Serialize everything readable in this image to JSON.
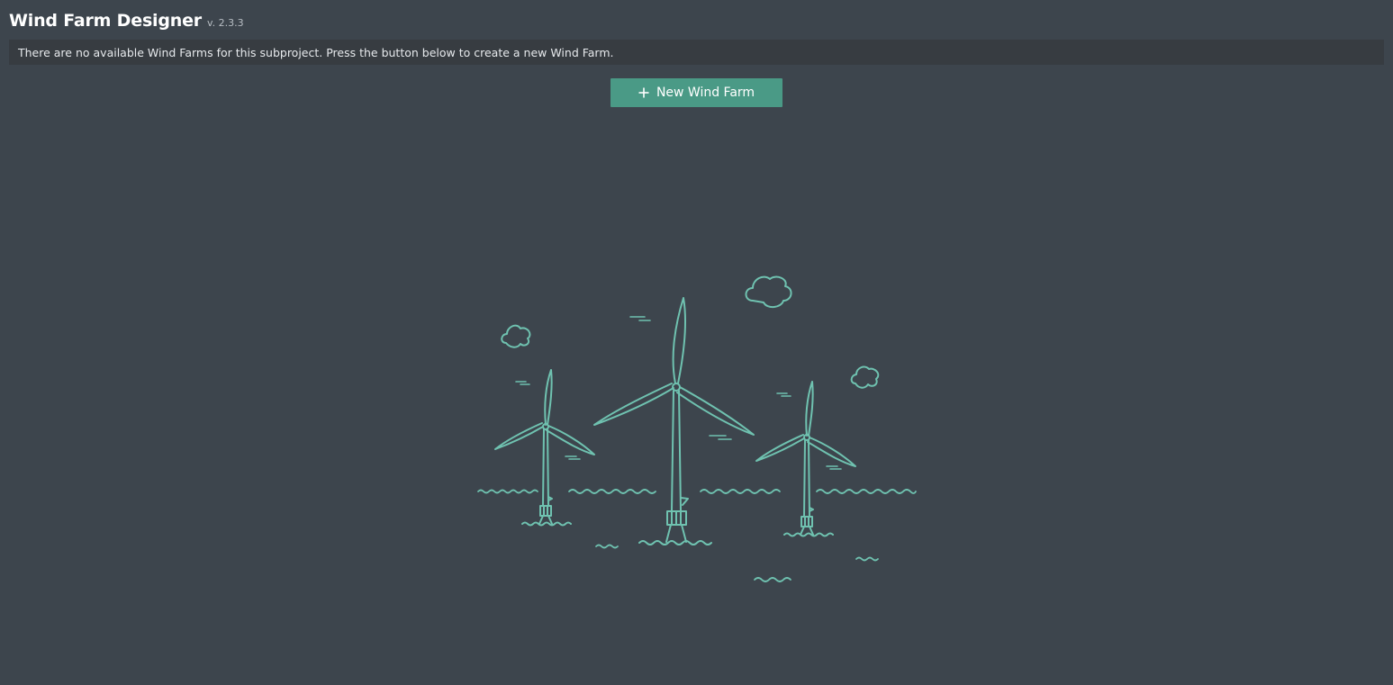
{
  "header": {
    "title": "Wind Farm Designer",
    "version": "v. 2.3.3"
  },
  "notice": {
    "message": "There are no available Wind Farms for this subproject. Press the button below to create a new Wind Farm."
  },
  "actions": {
    "new_wind_farm_label": "New Wind Farm",
    "new_wind_farm_icon": "plus-icon"
  },
  "illustration": {
    "icon": "wind-turbines-illustration",
    "line_color": "#6fc2b0"
  },
  "colors": {
    "background": "#3d454d",
    "notice_background": "#373c41",
    "accent": "#4a9a86"
  }
}
